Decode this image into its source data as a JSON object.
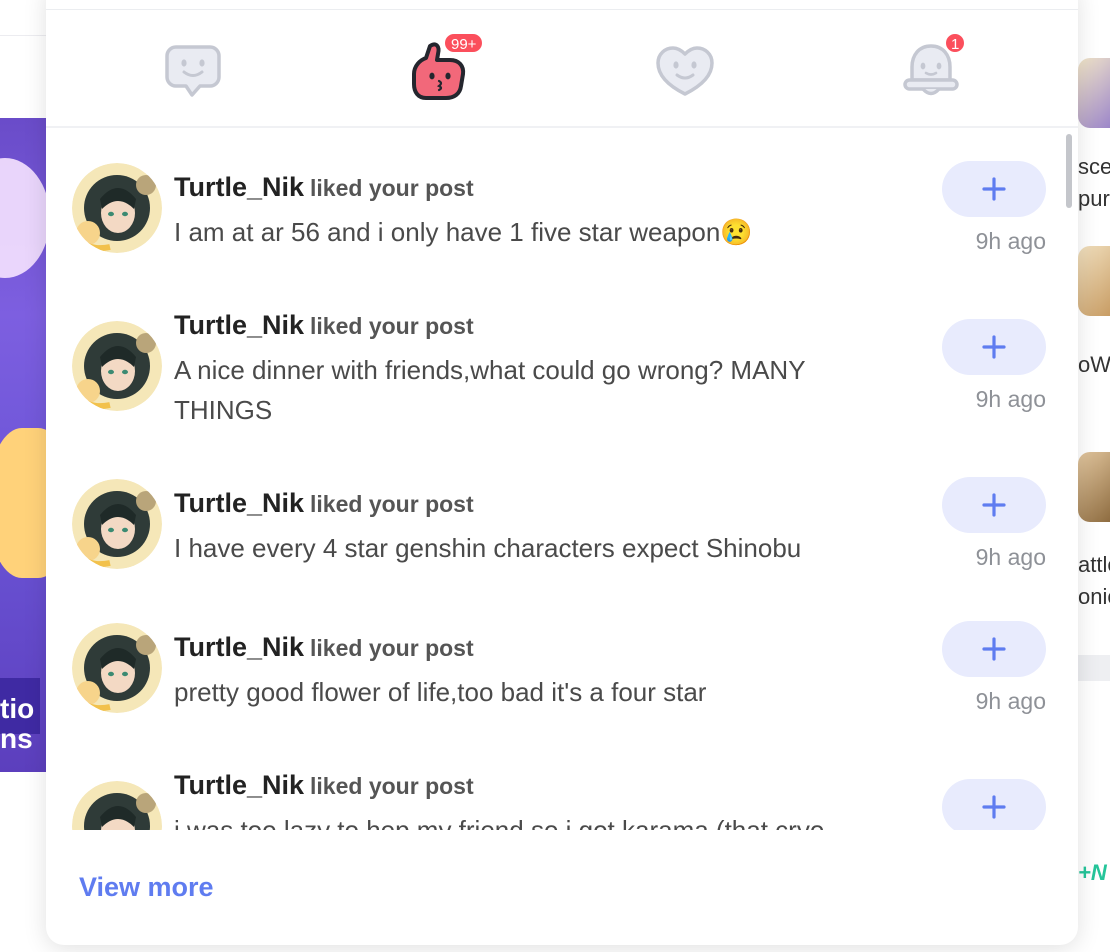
{
  "background": {
    "banner_text": "tio\nns",
    "right_texts": [
      "scer",
      "pur",
      "oW",
      "attle",
      "onic"
    ],
    "green_text": "+N"
  },
  "tabs": [
    {
      "icon": "comment-face-icon",
      "label": "Comments",
      "badge": ""
    },
    {
      "icon": "like-thumb-icon",
      "label": "Likes",
      "badge": "99+",
      "active": true
    },
    {
      "icon": "heart-face-icon",
      "label": "Followers",
      "badge": ""
    },
    {
      "icon": "bell-icon",
      "label": "System",
      "badge": "1"
    }
  ],
  "notifications": [
    {
      "user": "Turtle_Nik",
      "action": "liked your post",
      "text": "I am at ar 56 and i only have 1 five star weapon😢",
      "time": "9h ago"
    },
    {
      "user": "Turtle_Nik",
      "action": "liked your post",
      "text": "A nice dinner with friends,what could go wrong? MANY THINGS",
      "time": "9h ago"
    },
    {
      "user": "Turtle_Nik",
      "action": "liked your post",
      "text": "I have every 4 star genshin characters expect Shinobu",
      "time": "9h ago"
    },
    {
      "user": "Turtle_Nik",
      "action": "liked your post",
      "text": "pretty good flower of life,too bad it's a four star",
      "time": "9h ago"
    },
    {
      "user": "Turtle_Nik",
      "action": "liked your post",
      "text": "i was too lazy to hep my friend so i got karama (that cryo",
      "time": ""
    }
  ],
  "footer": {
    "view_more": "View more"
  },
  "colors": {
    "accent": "#5f7cf0",
    "badge": "#fb4f5c",
    "follow_bg": "#e8ebfd"
  }
}
